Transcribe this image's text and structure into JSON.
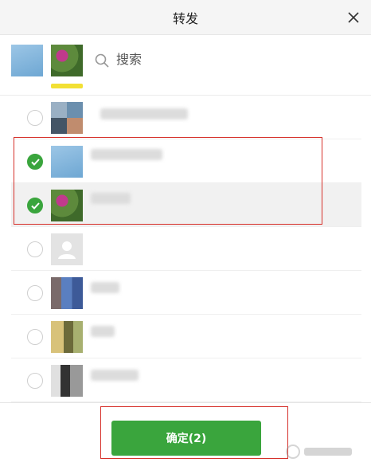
{
  "header": {
    "title": "转发"
  },
  "search": {
    "placeholder": "搜索",
    "value": ""
  },
  "contacts": [
    {
      "checked": false,
      "name": ""
    },
    {
      "checked": true,
      "name": ""
    },
    {
      "checked": true,
      "name": ""
    },
    {
      "checked": false,
      "name": ""
    },
    {
      "checked": false,
      "name": ""
    },
    {
      "checked": false,
      "name": ""
    },
    {
      "checked": false,
      "name": ""
    }
  ],
  "footer": {
    "confirm_label": "确定(2)"
  },
  "colors": {
    "accent": "#3aa53d",
    "highlight_box": "#d6302a",
    "yellow": "#f2e034"
  },
  "icons": [
    "close-icon",
    "search-icon",
    "checkmark-icon",
    "default-avatar-icon"
  ]
}
